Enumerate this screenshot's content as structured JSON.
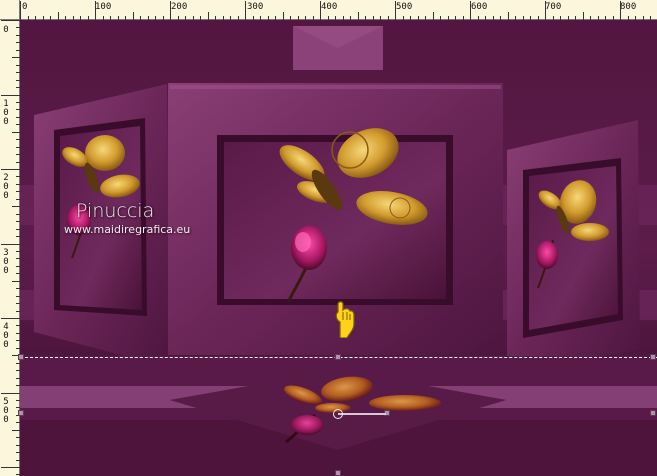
{
  "ruler": {
    "top_labels": [
      "0",
      "100",
      "200",
      "300",
      "400",
      "500",
      "600",
      "700",
      "800"
    ],
    "left_labels": [
      {
        "chars": [
          "0"
        ]
      },
      {
        "chars": [
          "1",
          "0",
          "0"
        ]
      },
      {
        "chars": [
          "2",
          "0",
          "0"
        ]
      },
      {
        "chars": [
          "3",
          "0",
          "0"
        ]
      },
      {
        "chars": [
          "4",
          "0",
          "0"
        ]
      },
      {
        "chars": [
          "5",
          "0",
          "0"
        ]
      }
    ]
  },
  "watermark": {
    "name": "Pinuccia",
    "url": "www.maidiregrafica.eu"
  },
  "colors": {
    "canvas_bg": "#4a1238",
    "frame": "#6e2a5c",
    "frame_light": "#8a3f75",
    "frame_dark": "#3a0c2c",
    "band": "#9a5189",
    "butterfly_gold": "#d4a23a",
    "flower": "#b01a6a",
    "selection": "#ffffff"
  },
  "icons": {
    "pointer": "hand-pointer-icon",
    "butterfly": "butterfly-coin-image"
  }
}
